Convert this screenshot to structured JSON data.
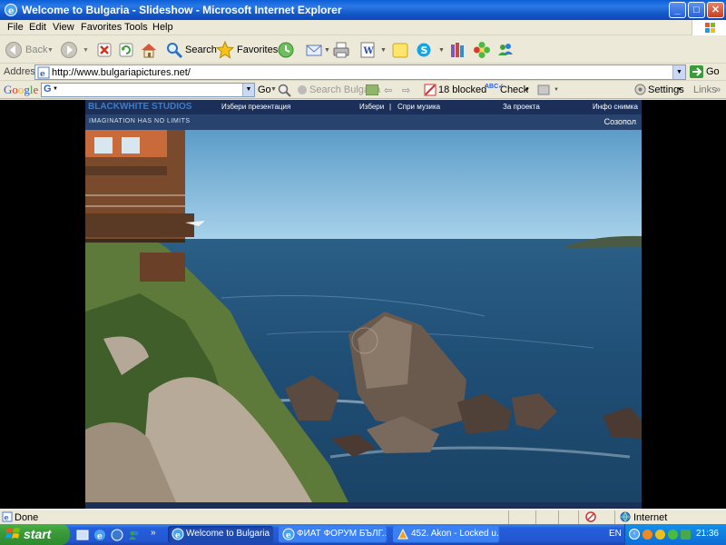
{
  "window": {
    "title": "Welcome to Bulgaria - Slideshow - Microsoft Internet Explorer",
    "minimize_label": "_",
    "maximize_label": "□",
    "close_label": "✕"
  },
  "menu": {
    "items": [
      "File",
      "Edit",
      "View",
      "Favorites",
      "Tools",
      "Help"
    ]
  },
  "toolbar": {
    "back_label": "Back",
    "search_label": "Search",
    "favorites_label": "Favorites"
  },
  "address": {
    "label": "Address",
    "url": "http://www.bulgariapictures.net/",
    "go_label": "Go"
  },
  "google_bar": {
    "logo": "Google",
    "go_label": "Go",
    "search_placeholder": "Search Bulgaria",
    "blocked_label": "18 blocked",
    "check_label": "Check",
    "settings_label": "Settings",
    "links_label": "Links"
  },
  "site": {
    "brand": "BLACKWHITE STUDIOS",
    "tagline": "IMAGINATION HAS NO LIMITS",
    "nav": [
      "Избери презентация",
      "Избери",
      "|",
      "Спри музика",
      "За проекта",
      "Инфо снимка"
    ],
    "location": "Созопол"
  },
  "status": {
    "text": "Done",
    "zone": "Internet"
  },
  "taskbar": {
    "start_label": "start",
    "tasks": [
      "Welcome to Bulgaria - ...",
      "ФИАТ ФОРУМ БЪЛГ...",
      "452. Akon - Locked u..."
    ],
    "language": "EN",
    "clock": "21:36"
  }
}
